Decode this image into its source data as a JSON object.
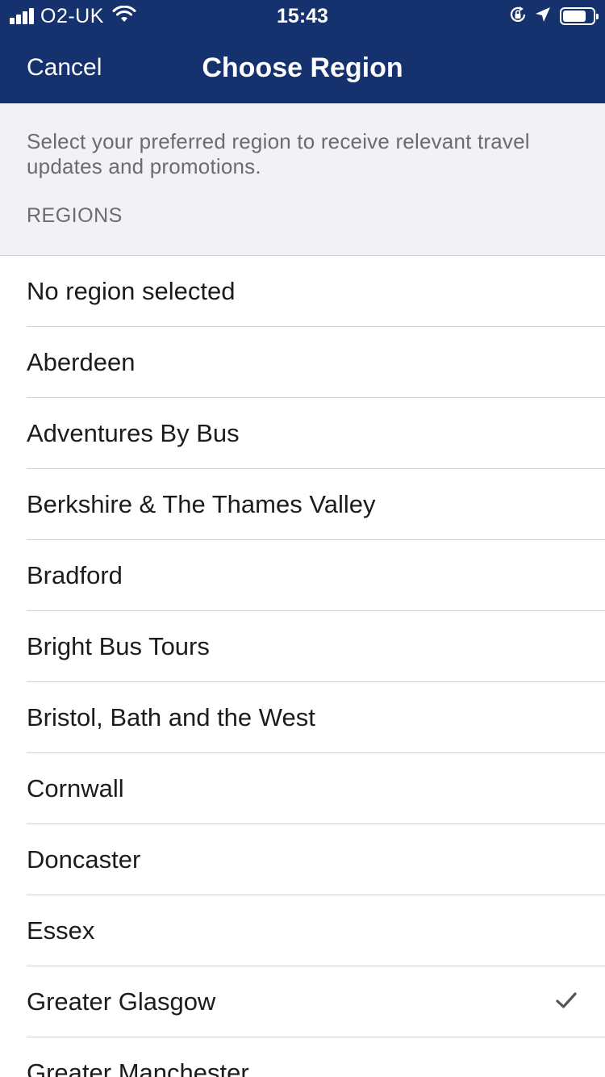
{
  "status_bar": {
    "carrier": "O2-UK",
    "time": "15:43",
    "signal_bars": 4
  },
  "nav": {
    "cancel_label": "Cancel",
    "title": "Choose Region"
  },
  "intro": {
    "description": "Select your preferred region to receive relevant travel updates and promotions.",
    "section_label": "REGIONS"
  },
  "regions": [
    {
      "label": "No region selected",
      "selected": false
    },
    {
      "label": "Aberdeen",
      "selected": false
    },
    {
      "label": "Adventures By Bus",
      "selected": false
    },
    {
      "label": "Berkshire & The Thames Valley",
      "selected": false
    },
    {
      "label": "Bradford",
      "selected": false
    },
    {
      "label": "Bright Bus Tours",
      "selected": false
    },
    {
      "label": "Bristol, Bath and the West",
      "selected": false
    },
    {
      "label": "Cornwall",
      "selected": false
    },
    {
      "label": "Doncaster",
      "selected": false
    },
    {
      "label": "Essex",
      "selected": false
    },
    {
      "label": "Greater Glasgow",
      "selected": true
    },
    {
      "label": "Greater Manchester",
      "selected": false
    }
  ],
  "colors": {
    "nav_background": "#15326e",
    "section_background": "#f1f1f6",
    "checkmark": "#555555"
  },
  "icons": {
    "status": [
      "wifi-icon",
      "orientation-lock-icon",
      "location-arrow-icon",
      "battery-icon"
    ],
    "selected_marker": "checkmark-icon"
  }
}
